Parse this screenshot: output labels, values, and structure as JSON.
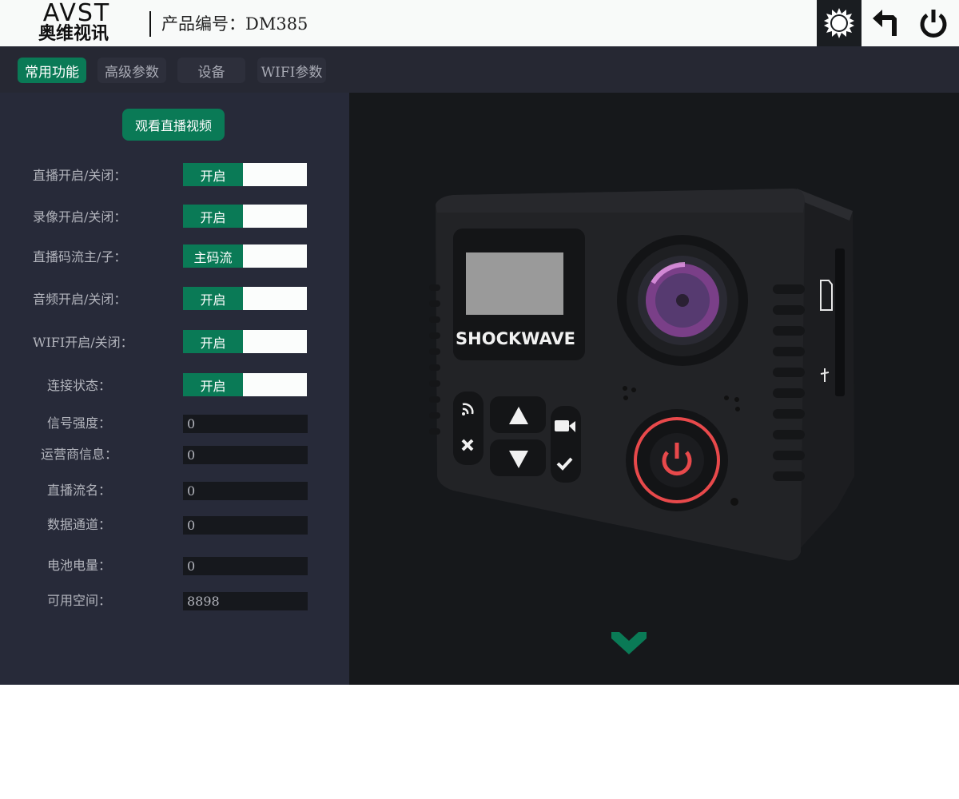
{
  "header": {
    "logo_en": "AVST",
    "logo_cn": "奥维视讯",
    "product_label": "产品编号：DM385",
    "icons": [
      "gear-icon",
      "back-arrow-icon",
      "power-icon"
    ]
  },
  "tabs": [
    {
      "label": "常用功能",
      "active": true
    },
    {
      "label": "高级参数",
      "active": false
    },
    {
      "label": "设备",
      "active": false
    },
    {
      "label": "WIFI参数",
      "active": false
    }
  ],
  "left": {
    "live_button": "观看直播视频",
    "toggles": [
      {
        "label": "直播开启/关闭：",
        "value": "开启"
      },
      {
        "label": "录像开启/关闭：",
        "value": "开启"
      },
      {
        "label": "直播码流主/子：",
        "value": "主码流"
      },
      {
        "label": "音频开启/关闭：",
        "value": "开启"
      },
      {
        "label": "WIFI开启/关闭：",
        "value": "开启"
      },
      {
        "label": "连接状态：",
        "value": "开启"
      }
    ],
    "fields": [
      {
        "label": "信号强度：",
        "value": "0"
      },
      {
        "label": "运营商信息：",
        "value": "0"
      },
      {
        "label": "直播流名：",
        "value": "0"
      },
      {
        "label": "数据通道：",
        "value": "0"
      },
      {
        "label": "电池电量：",
        "value": "0"
      },
      {
        "label": "可用空间：",
        "value": "8898"
      }
    ]
  },
  "camera": {
    "brand": "SHOCKWAVE"
  },
  "colors": {
    "accent": "#0a7a56",
    "header_bg": "#f8faf9",
    "tab_bar_bg": "#262833",
    "left_bg": "#272a39",
    "right_bg": "#16181b",
    "power_ring": "#e8494b"
  }
}
